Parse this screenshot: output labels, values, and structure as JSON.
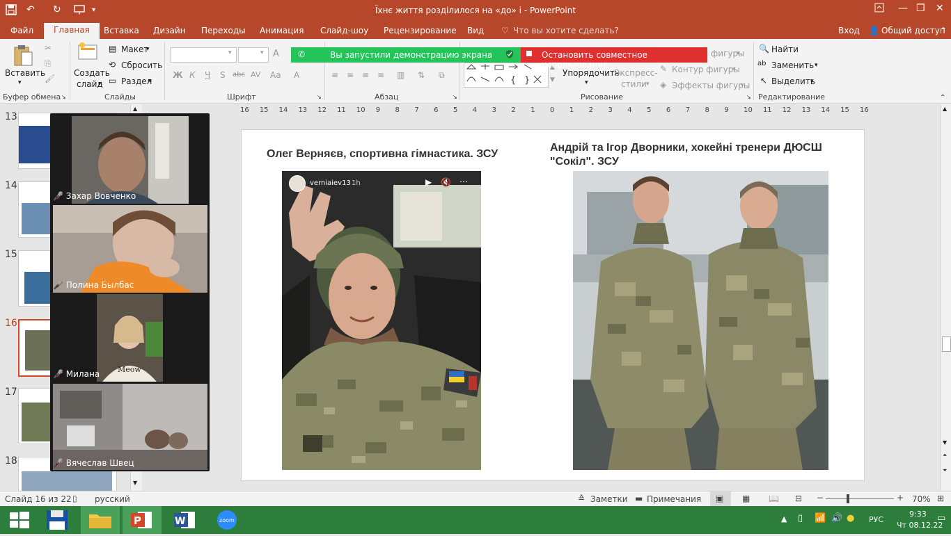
{
  "window": {
    "title": "Їхнє життя розділилося на «до» і - PowerPoint",
    "quick_access_icons": [
      "save-icon",
      "undo-icon",
      "redo-icon",
      "present-icon",
      "customize-icon"
    ],
    "controls": [
      "ribbon-display-icon",
      "minimize-icon",
      "restore-icon",
      "close-icon"
    ]
  },
  "menu": {
    "tabs": [
      "Файл",
      "Главная",
      "Вставка",
      "Дизайн",
      "Переходы",
      "Анимация",
      "Слайд-шоу",
      "Рецензирование",
      "Вид"
    ],
    "active_tab": "Главная",
    "tell_me": "Что вы хотите сделать?",
    "signin": "Вход",
    "share": "Общий доступ"
  },
  "ribbon": {
    "clipboard": {
      "paste": "Вставить",
      "label": "Буфер обмена"
    },
    "slides": {
      "new_slide_line1": "Создать",
      "new_slide_line2": "слайд",
      "layout": "Макет",
      "reset": "Сбросить",
      "section": "Раздел",
      "label": "Слайды"
    },
    "font": {
      "label": "Шрифт",
      "bold": "Ж",
      "italic": "К",
      "underline": "Ч",
      "shadow": "S",
      "strike": "abc",
      "spacing": "AV",
      "case": "Aa",
      "grow": "A",
      "shrink": "A"
    },
    "paragraph": {
      "label": "Абзац"
    },
    "drawing": {
      "arrange": "Упорядочить",
      "quick_styles_line1": "Экспресс-",
      "quick_styles_line2": "стили",
      "fill": "Заливка фигуры",
      "outline": "Контур фигуры",
      "effects": "Эффекты фигуры",
      "label": "Рисование"
    },
    "editing": {
      "find": "Найти",
      "replace": "Заменить",
      "select": "Выделить",
      "label": "Редактирование"
    }
  },
  "share_banner": {
    "status": "Вы запустили демонстрацию экрана",
    "stop": "Остановить совместное использование",
    "status_color": "#24c45a",
    "stop_color": "#e02f2f"
  },
  "ruler": {
    "ticks": [
      "16",
      "15",
      "14",
      "13",
      "12",
      "11",
      "10",
      "9",
      "8",
      "7",
      "6",
      "5",
      "4",
      "3",
      "2",
      "1",
      "0",
      "1",
      "2",
      "3",
      "4",
      "5",
      "6",
      "7",
      "8",
      "9",
      "10",
      "11",
      "12",
      "13",
      "14",
      "15",
      "16"
    ]
  },
  "thumbnails": [
    {
      "num": "13"
    },
    {
      "num": "14"
    },
    {
      "num": "15"
    },
    {
      "num": "16",
      "selected": true
    },
    {
      "num": "17"
    },
    {
      "num": "18"
    }
  ],
  "slide": {
    "left_caption": "Олег Верняєв, спортивна гімнастика. ЗСУ",
    "right_caption_line1": "Андрій та Ігор Дворники, хокейні тренери ДЮСШ",
    "right_caption_line2": "\"Сокіл\". ЗСУ",
    "story_handle": "verniaiev13",
    "story_age": "1h"
  },
  "participants": [
    {
      "name": "Захар Вовченко",
      "muted": true
    },
    {
      "name": "Полина Былбас",
      "muted": true
    },
    {
      "name": "Милана",
      "muted": true
    },
    {
      "name": "Вячеслав Швец",
      "muted": true
    }
  ],
  "status_bar": {
    "slide_info": "Слайд 16 из 22",
    "language": "русский",
    "notes": "Заметки",
    "comments": "Примечания",
    "zoom": "70%"
  },
  "taskbar": {
    "apps": [
      "windows-start-icon",
      "save-disk-icon",
      "file-explorer-icon",
      "powerpoint-icon",
      "word-icon",
      "zoom-icon"
    ],
    "lang": "РУС",
    "time": "9:33",
    "date": "Чт 08.12.22"
  }
}
